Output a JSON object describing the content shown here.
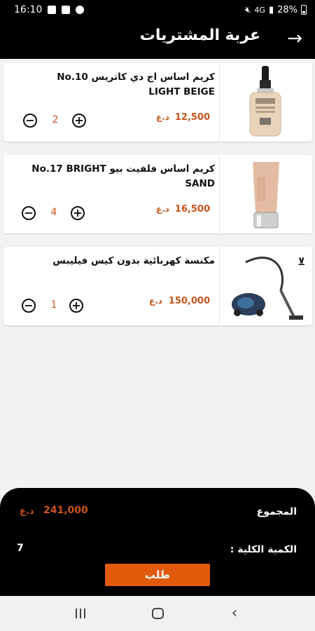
{
  "status_bar": {
    "time": "16:10",
    "network": "4G",
    "battery": "28%"
  },
  "header": {
    "title": "عربة المشتريات",
    "back_icon": "arrow-right-icon"
  },
  "cart": {
    "items": [
      {
        "name_line1": "كريم اساس اج دي كاتريس No.10",
        "name_line2": "LIGHT BEIGE",
        "price": "12,500",
        "currency": "د.ع",
        "quantity": "2",
        "image_icon": "foundation-dropper-bottle-image"
      },
      {
        "name_line1": "كريم اساس فلفيت بيو No.17 BRIGHT",
        "name_line2": "SAND",
        "price": "16,500",
        "currency": "د.ع",
        "quantity": "4",
        "image_icon": "foundation-tube-image"
      },
      {
        "name_line1": "مكنسة كهربائية بدون كيس فيليبس",
        "name_line2": "",
        "price": "150,000",
        "currency": "د.ع",
        "quantity": "1",
        "image_icon": "vacuum-cleaner-image",
        "side_icon": "filter-icon"
      }
    ]
  },
  "summary": {
    "total_label": "المجموع",
    "total_value": "241,000",
    "currency": "د.ع",
    "quantity_label": "الكمية الكلية :",
    "quantity_value": "7",
    "order_button": "طلب"
  },
  "colors": {
    "accent": "#c9541a",
    "button": "#e25a0b",
    "header_bg": "#000000"
  }
}
